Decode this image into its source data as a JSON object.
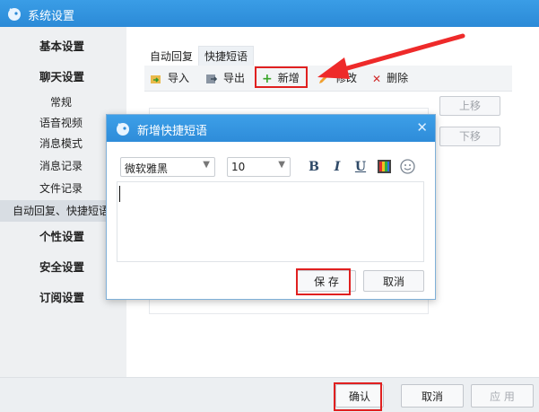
{
  "window": {
    "title": "系统设置"
  },
  "sidebar": {
    "items": [
      {
        "label": "基本设置"
      },
      {
        "label": "聊天设置"
      },
      {
        "label": "常规"
      },
      {
        "label": "语音视频"
      },
      {
        "label": "消息模式"
      },
      {
        "label": "消息记录"
      },
      {
        "label": "文件记录"
      },
      {
        "label": "自动回复、快捷短语"
      },
      {
        "label": "个性设置"
      },
      {
        "label": "安全设置"
      },
      {
        "label": "订阅设置"
      }
    ]
  },
  "main": {
    "tabs": [
      {
        "label": "自动回复"
      },
      {
        "label": "快捷短语"
      }
    ],
    "toolbar": {
      "import": "导入",
      "export": "导出",
      "add": "新增",
      "edit": "修改",
      "delete": "删除"
    },
    "side_buttons": {
      "up": "上移",
      "down": "下移"
    }
  },
  "dialog": {
    "title": "新增快捷短语",
    "font": "微软雅黑",
    "size": "10",
    "format": {
      "bold": "B",
      "italic": "I",
      "underline": "U"
    },
    "save": "保 存",
    "cancel": "取消"
  },
  "footer": {
    "ok": "确认",
    "cancel": "取消",
    "apply": "应 用"
  },
  "colors": {
    "accent": "#2b8ad7",
    "highlight": "#e02020"
  }
}
